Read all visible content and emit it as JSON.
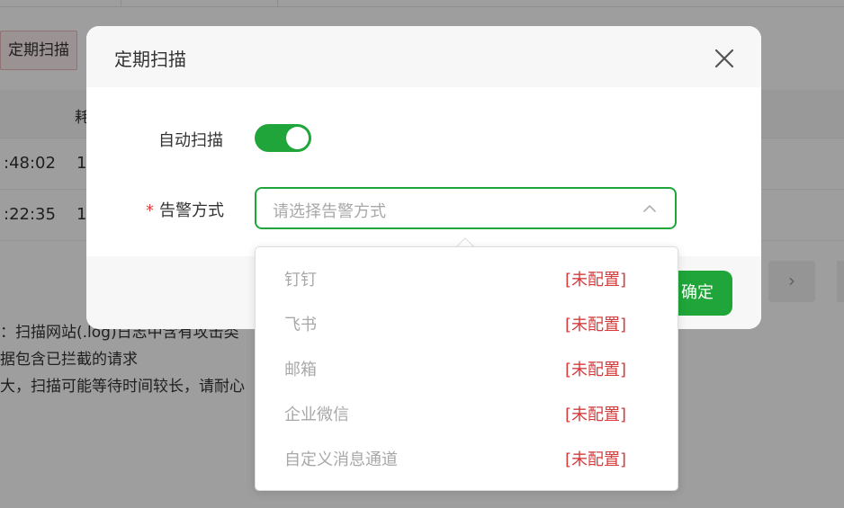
{
  "background": {
    "scan_button_label": "定期扫描",
    "table_header_fragment": "耗",
    "rows": [
      {
        "time": ":48:02",
        "col2": "1"
      },
      {
        "time": ":22:35",
        "col2": "1"
      }
    ],
    "pager_next_symbol": "›",
    "notes": [
      "：扫描网站(.log)日志中含有攻击类",
      "据包含已拦截的请求",
      "大，扫描可能等待时间较长，请耐心"
    ]
  },
  "modal": {
    "title": "定期扫描",
    "close_icon": "close-icon",
    "auto_scan_label": "自动扫描",
    "auto_scan_enabled": true,
    "alert_method_label": "告警方式",
    "required_mark": "*",
    "alert_method_placeholder": "请选择告警方式",
    "confirm_label": "确定",
    "accent_color": "#20a53a"
  },
  "dropdown": {
    "options": [
      {
        "label": "钉钉",
        "status": "[未配置]"
      },
      {
        "label": "飞书",
        "status": "[未配置]"
      },
      {
        "label": "邮箱",
        "status": "[未配置]"
      },
      {
        "label": "企业微信",
        "status": "[未配置]"
      },
      {
        "label": "自定义消息通道",
        "status": "[未配置]"
      }
    ],
    "status_color": "#d63b3b"
  }
}
